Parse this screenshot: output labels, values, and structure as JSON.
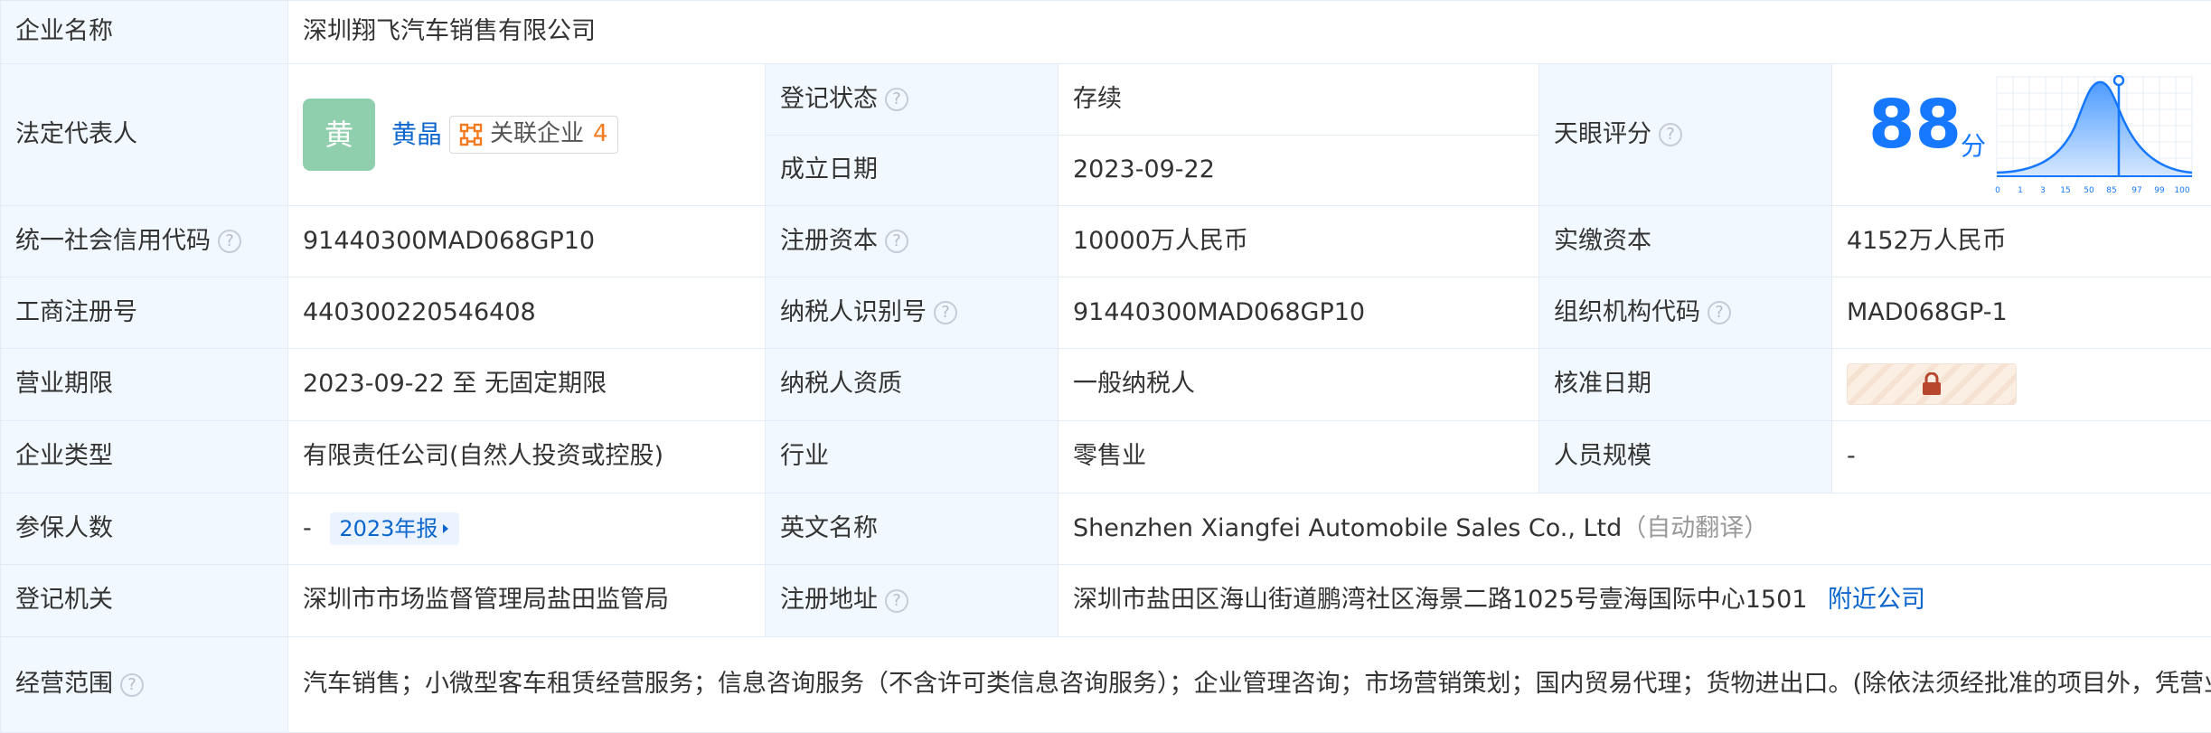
{
  "labels": {
    "company_name": "企业名称",
    "legal_rep": "法定代表人",
    "reg_status": "登记状态",
    "found_date": "成立日期",
    "tianyan_score": "天眼评分",
    "credit_code": "统一社会信用代码",
    "reg_capital": "注册资本",
    "paid_capital": "实缴资本",
    "business_reg_no": "工商注册号",
    "taxpayer_id": "纳税人识别号",
    "org_code": "组织机构代码",
    "business_term": "营业期限",
    "taxpayer_qual": "纳税人资质",
    "approval_date": "核准日期",
    "company_type": "企业类型",
    "industry": "行业",
    "staff_size": "人员规模",
    "insured": "参保人数",
    "english_name": "英文名称",
    "reg_authority": "登记机关",
    "reg_address": "注册地址",
    "business_scope": "经营范围"
  },
  "values": {
    "company_name": "深圳翔飞汽车销售有限公司",
    "legal_rep_avatar": "黄",
    "legal_rep_name": "黄晶",
    "related_label": "关联企业",
    "related_count": "4",
    "reg_status": "存续",
    "found_date": "2023-09-22",
    "score": "88",
    "score_unit": "分",
    "credit_code": "91440300MAD068GP10",
    "reg_capital": "10000万人民币",
    "paid_capital": "4152万人民币",
    "business_reg_no": "440300220546408",
    "taxpayer_id": "91440300MAD068GP10",
    "org_code": "MAD068GP-1",
    "business_term": "2023-09-22 至 无固定期限",
    "taxpayer_qual": "一般纳税人",
    "company_type": "有限责任公司(自然人投资或控股)",
    "industry": "零售业",
    "staff_size": "-",
    "insured": "-",
    "annual_report": "2023年报",
    "english_name": "Shenzhen Xiangfei Automobile Sales Co., Ltd",
    "auto_translate": "（自动翻译）",
    "reg_authority": "深圳市市场监督管理局盐田监管局",
    "reg_address": "深圳市盐田区海山街道鹏湾社区海景二路1025号壹海国际中心1501",
    "nearby": "附近公司",
    "business_scope": "汽车销售；小微型客车租赁经营服务；信息咨询服务（不含许可类信息咨询服务）；企业管理咨询；市场营销策划；国内贸易代理；货物进出口。(除依法须经批准的项目外，凭营业执照依法自主开展经营活动）无"
  },
  "score_axis_ticks": [
    "0",
    "1",
    "3",
    "15",
    "50",
    "85",
    "97",
    "99",
    "100"
  ],
  "icons": {
    "help": "question-circle-icon",
    "related": "network-icon",
    "report_arrow": "caret-right-icon",
    "lock": "lock-icon"
  },
  "colors": {
    "label_bg": "#f2f8ff",
    "border": "#e3ebf6",
    "link": "#0a66cc",
    "status_green": "#17a34a",
    "score_blue": "#1677ff",
    "related_count": "#f47b20",
    "avatar_bg": "#8fcfae",
    "lock": "#b8452e"
  }
}
